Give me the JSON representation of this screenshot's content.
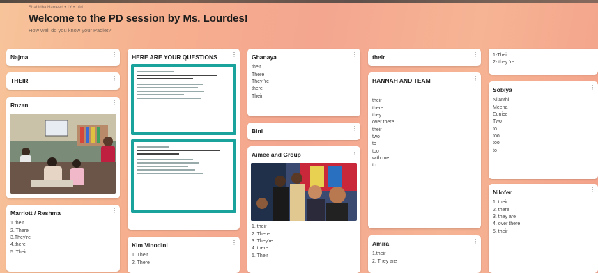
{
  "header": {
    "meta": "Shahidha Hameed • 1Y • 10d",
    "title": "Welcome to the PD session by Ms. Lourdes!",
    "subtitle": "How well do you know your Padlet?"
  },
  "menu_glyph": "⋮",
  "col1": {
    "najma": {
      "title": "Najma"
    },
    "their": {
      "title": "THEIR"
    },
    "rozan": {
      "title": "Rozan"
    },
    "marriott": {
      "title": "Marriott / Reshma",
      "items": [
        "1.their",
        "2. There",
        "3.They're",
        "4.there",
        "5. Their"
      ]
    }
  },
  "col2": {
    "questions": {
      "title": "HERE ARE YOUR QUESTIONS"
    },
    "kim": {
      "title": "Kim Vinodini",
      "items": [
        "1. Their",
        "2. There"
      ]
    }
  },
  "col3": {
    "ghanaya": {
      "title": "Ghanaya",
      "items": [
        "their",
        "There",
        "They 're",
        "there",
        "Their"
      ]
    },
    "bini": {
      "title": "Bini"
    },
    "aimee": {
      "title": "Aimee and Group",
      "items": [
        "1. their",
        "2. There",
        "3. They're",
        "4. there",
        "5. Their"
      ]
    }
  },
  "col4": {
    "their": {
      "title": "their"
    },
    "hannah": {
      "title": "HANNAH AND TEAM",
      "items": [
        "their",
        "there",
        "they",
        "over there",
        "their",
        "two",
        "to",
        "too",
        "with me",
        "to"
      ]
    },
    "amira": {
      "title": "Amira",
      "items": [
        "1.their",
        "2. They are"
      ]
    }
  },
  "col5": {
    "top": {
      "items": [
        "1-Their",
        "2- they 're"
      ]
    },
    "sobiya": {
      "title": "Sobiya",
      "items": [
        "Nilanthi",
        "Meena",
        "Eunice",
        "Two",
        "to",
        "too",
        "too",
        "to"
      ]
    },
    "nilofer": {
      "title": "Nilofer",
      "items": [
        "1. their",
        "2. there",
        "3. they are",
        "4. over there",
        "5. their"
      ]
    }
  }
}
